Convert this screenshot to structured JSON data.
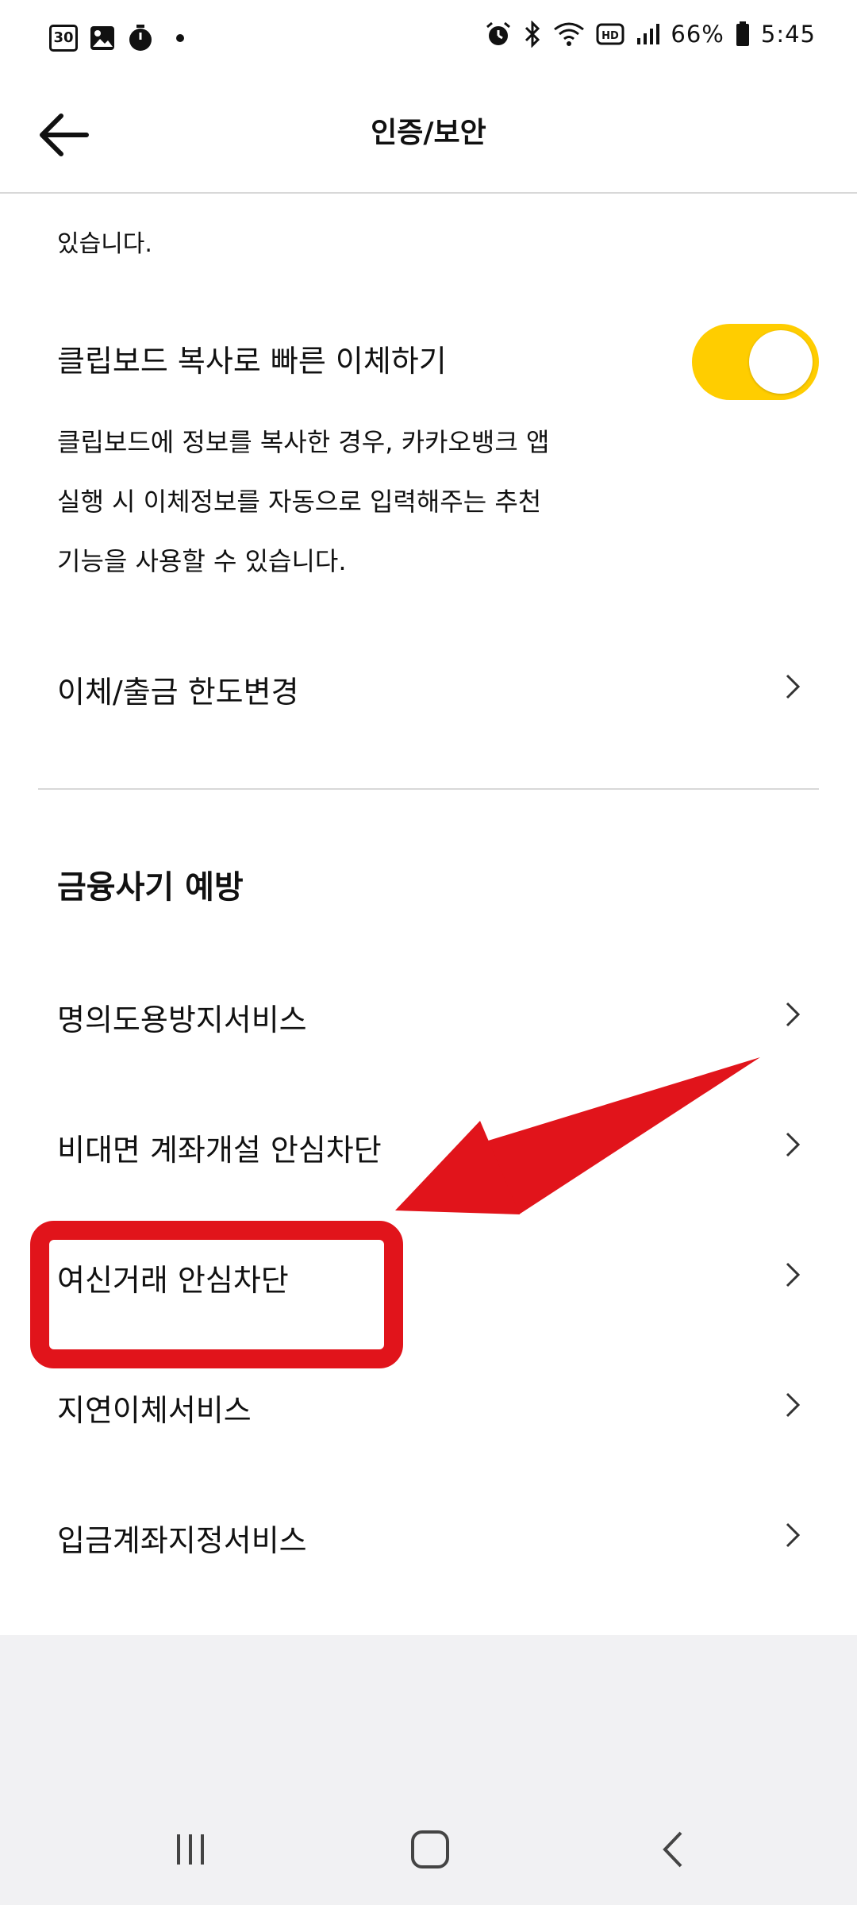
{
  "status_bar": {
    "date_icon_text": "30",
    "battery_percent": "66%",
    "time": "5:45",
    "icons": [
      "calendar-icon",
      "gallery-icon",
      "timer-icon",
      "alarm-icon",
      "bluetooth-icon",
      "wifi-icon",
      "hd-icon",
      "signal-icon",
      "battery-icon"
    ]
  },
  "header": {
    "title": "인증/보안"
  },
  "content": {
    "partial_text": "있습니다.",
    "clipboard": {
      "title": "클립보드 복사로 빠른 이체하기",
      "toggle_on": true,
      "description": [
        "클립보드에 정보를 복사한 경우, 카카오뱅크 앱",
        "실행 시 이체정보를 자동으로 입력해주는 추천",
        "기능을 사용할 수 있습니다."
      ]
    },
    "limit_change": "이체/출금 한도변경",
    "fraud_section": {
      "title": "금융사기 예방",
      "items": [
        "명의도용방지서비스",
        "비대면 계좌개설 안심차단",
        "여신거래 안심차단",
        "지연이체서비스",
        "입금계좌지정서비스"
      ]
    }
  },
  "colors": {
    "accent": "#FFCD00",
    "annotation": "#E1141B"
  }
}
